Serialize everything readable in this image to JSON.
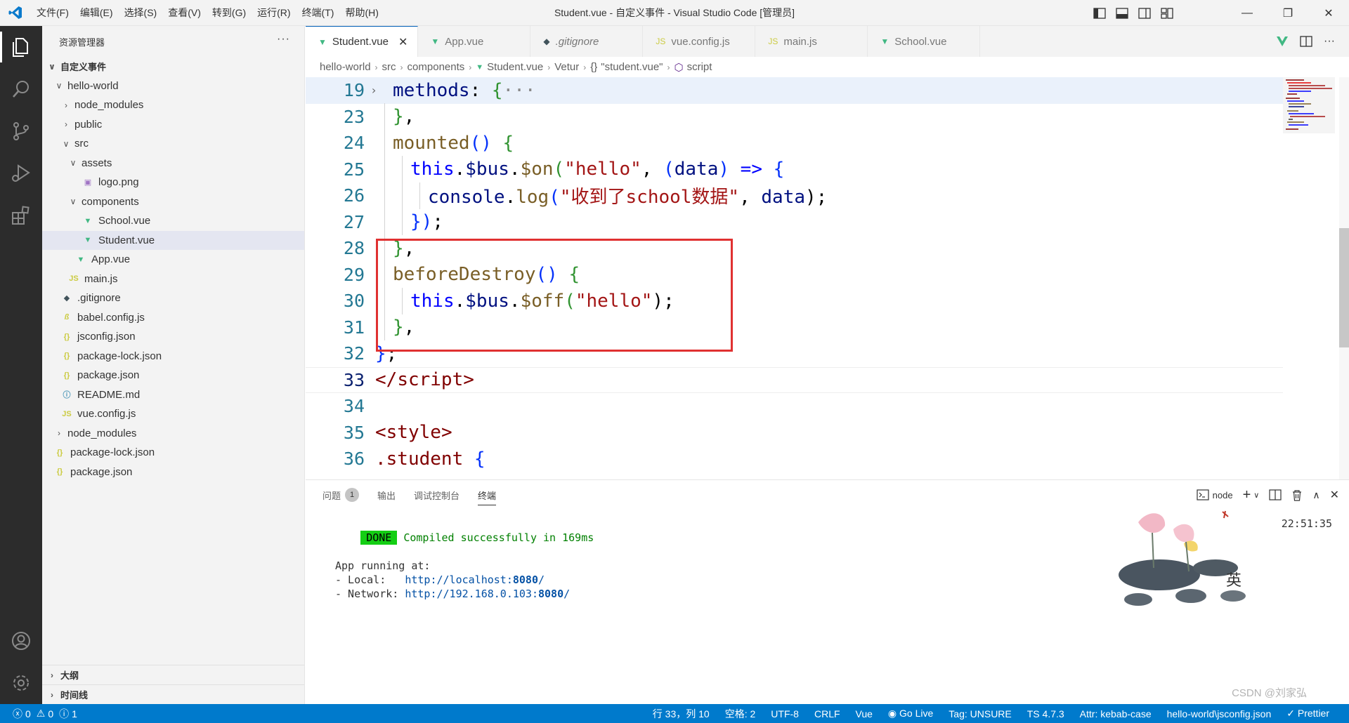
{
  "titlebar": {
    "menu": [
      "文件(F)",
      "编辑(E)",
      "选择(S)",
      "查看(V)",
      "转到(G)",
      "运行(R)",
      "终端(T)",
      "帮助(H)"
    ],
    "title": "Student.vue - 自定义事件 - Visual Studio Code [管理员]"
  },
  "sidebar": {
    "header": "资源管理器",
    "items": [
      {
        "label": "自定义事件"
      },
      {
        "label": "hello-world"
      },
      {
        "label": "node_modules"
      },
      {
        "label": "public"
      },
      {
        "label": "src"
      },
      {
        "label": "assets"
      },
      {
        "label": "logo.png"
      },
      {
        "label": "components"
      },
      {
        "label": "School.vue"
      },
      {
        "label": "Student.vue"
      },
      {
        "label": "App.vue"
      },
      {
        "label": "main.js"
      },
      {
        "label": ".gitignore"
      },
      {
        "label": "babel.config.js"
      },
      {
        "label": "jsconfig.json"
      },
      {
        "label": "package-lock.json"
      },
      {
        "label": "package.json"
      },
      {
        "label": "README.md"
      },
      {
        "label": "vue.config.js"
      },
      {
        "label": "node_modules"
      },
      {
        "label": "package-lock.json"
      },
      {
        "label": "package.json"
      }
    ],
    "outline": "大纲",
    "timeline": "时间线"
  },
  "tabs": [
    {
      "label": "Student.vue",
      "icon": "vue-icon"
    },
    {
      "label": "App.vue",
      "icon": "vue-icon"
    },
    {
      "label": ".gitignore",
      "icon": "git-icon"
    },
    {
      "label": "vue.config.js",
      "icon": "js-icon"
    },
    {
      "label": "main.js",
      "icon": "js-icon"
    },
    {
      "label": "School.vue",
      "icon": "vue-icon"
    }
  ],
  "icon_text": {
    "js": "JS",
    "json": "{}"
  },
  "breadcrumb": [
    "hello-world",
    "src",
    "components",
    "Student.vue",
    "Vetur",
    "\"student.vue\"",
    "script"
  ],
  "code": {
    "line_numbers": [
      "19",
      "23",
      "24",
      "25",
      "26",
      "27",
      "28",
      "29",
      "30",
      "31",
      "32",
      "33",
      "34",
      "35",
      "36"
    ],
    "l19": {
      "a": "methods",
      "b": ": ",
      "c": "{",
      "d": "···"
    },
    "l23": {
      "a": "}",
      "b": ","
    },
    "l24": {
      "a": "mounted",
      "b": "() ",
      "c": "{"
    },
    "l25": {
      "a": "this",
      "b": ".",
      "c": "$bus",
      "d": ".",
      "e": "$on",
      "f": "(",
      "g": "\"hello\"",
      "h": ", ",
      "i": "(",
      "j": "data",
      "k": ")",
      "l": " => ",
      "m": "{"
    },
    "l26": {
      "a": "console",
      "b": ".",
      "c": "log",
      "d": "(",
      "e": "\"收到了school数据\"",
      "f": ", ",
      "g": "data",
      "h": ");"
    },
    "l27": {
      "a": "})",
      "b": ";"
    },
    "l28": {
      "a": "}",
      "b": ","
    },
    "l29": {
      "a": "beforeDestroy",
      "b": "() ",
      "c": "{"
    },
    "l30": {
      "a": "this",
      "b": ".",
      "c": "$bus",
      "d": ".",
      "e": "$off",
      "f": "(",
      "g": "\"hello\"",
      "h": ");"
    },
    "l31": {
      "a": "}",
      "b": ","
    },
    "l32": {
      "a": "}",
      "b": ";"
    },
    "l33": {
      "a": "</",
      "b": "script",
      "c": ">"
    },
    "l35": {
      "a": "<",
      "b": "style",
      "c": ">"
    },
    "l36": {
      "a": ".student",
      "b": " {"
    }
  },
  "panel": {
    "tabs": [
      "问题",
      "输出",
      "调试控制台",
      "终端"
    ],
    "problems_count": "1",
    "terminal_name": "node",
    "done": "DONE",
    "compiled": "Compiled successfully in 169ms",
    "time": "22:51:35",
    "app_running": "App running at:",
    "local_label": "- Local:   ",
    "local_url": "http://localhost:",
    "local_port": "8080",
    "local_tail": "/",
    "network_label": "- Network: ",
    "network_url": "http://192.168.0.103:",
    "network_port": "8080",
    "network_tail": "/"
  },
  "statusbar": {
    "errors": "0",
    "warnings": "0",
    "info": "1",
    "position": "行 33，列 10",
    "spaces": "空格: 2",
    "encoding": "UTF-8",
    "eol": "CRLF",
    "language": "Vue",
    "golive": "Go Live",
    "tag": "Tag: UNSURE",
    "ts": "TS 4.7.3",
    "attr": "Attr: kebab-case",
    "config": "hello-world\\jsconfig.json",
    "prettier": "Prettier"
  },
  "watermark_text": "CSDN @刘家弘",
  "colors": {
    "accent": "#007acc",
    "highlight": "#e03131",
    "done": "#14ce14"
  }
}
